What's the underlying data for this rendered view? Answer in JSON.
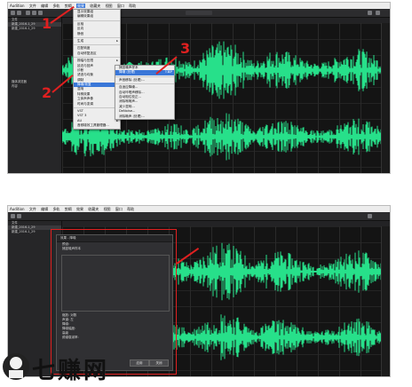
{
  "panel1": {
    "menubar": [
      "Audition",
      "文件",
      "编辑",
      "多轨",
      "剪辑",
      "效果",
      "收藏夹",
      "视图",
      "窗口",
      "帮助"
    ],
    "menubar_highlight_index": 5,
    "main_menu": [
      {
        "label": "显示效果组",
        "has_sub": false
      },
      {
        "label": "编辑效果组",
        "has_sub": false
      },
      {
        "label": "",
        "sep": true
      },
      {
        "label": "反相",
        "has_sub": false
      },
      {
        "label": "反向",
        "has_sub": false
      },
      {
        "label": "静音",
        "has_sub": false
      },
      {
        "label": "",
        "sep": true
      },
      {
        "label": "生成",
        "has_sub": true
      },
      {
        "label": "",
        "sep": true
      },
      {
        "label": "匹配响度",
        "has_sub": false
      },
      {
        "label": "自动修复选区",
        "has_sub": false
      },
      {
        "label": "",
        "sep": true
      },
      {
        "label": "振幅与压限",
        "has_sub": true
      },
      {
        "label": "延迟与回声",
        "has_sub": true
      },
      {
        "label": "诊断",
        "has_sub": true
      },
      {
        "label": "滤波与均衡",
        "has_sub": true
      },
      {
        "label": "调制",
        "has_sub": true
      },
      {
        "label": "降噪/恢复",
        "has_sub": true,
        "highlight": true
      },
      {
        "label": "混响",
        "has_sub": true
      },
      {
        "label": "特殊效果",
        "has_sub": true
      },
      {
        "label": "立体声声像",
        "has_sub": true
      },
      {
        "label": "时间与变调",
        "has_sub": true
      },
      {
        "label": "",
        "sep": true
      },
      {
        "label": "VST",
        "has_sub": true
      },
      {
        "label": "VST 3",
        "has_sub": true
      },
      {
        "label": "AU",
        "has_sub": true
      },
      {
        "label": "音频增效工具管理器...",
        "has_sub": false
      }
    ],
    "submenu": [
      {
        "label": "捕捉噪声样本",
        "highlight": false
      },
      {
        "label": "降噪 (处理)",
        "highlight": true,
        "shortcut": "⇧⌘P"
      },
      {
        "label": "",
        "sep": true
      },
      {
        "label": "声音移除 (处理)...",
        "highlight": false
      },
      {
        "label": "",
        "sep": true
      },
      {
        "label": "自适应降噪...",
        "highlight": false
      },
      {
        "label": "自动咔嗒声移除...",
        "highlight": false
      },
      {
        "label": "自动相位校正...",
        "highlight": false
      },
      {
        "label": "消除嗡嗡声...",
        "highlight": false
      },
      {
        "label": "减少混响...",
        "highlight": false
      },
      {
        "label": "DeNoise...",
        "highlight": false
      },
      {
        "label": "消除嘶声 (处理)...",
        "highlight": false
      }
    ],
    "files": [
      "新建_2016-1_29",
      "新建_2016-1_29"
    ],
    "left_rows": [
      "文件",
      "名称",
      "",
      "",
      "",
      "",
      "",
      "",
      "",
      "",
      "媒体浏览器",
      "内容",
      "",
      "",
      "",
      ""
    ],
    "annotations": [
      "1",
      "2",
      "3"
    ],
    "timecode": "0:00.000"
  },
  "panel2": {
    "menubar": [
      "Audition",
      "文件",
      "编辑",
      "多轨",
      "剪辑",
      "效果",
      "收藏夹",
      "视图",
      "窗口",
      "帮助"
    ],
    "dialog": {
      "title": "效果 - 降噪",
      "lines": [
        "预设:",
        "",
        "捕捉噪声样本",
        "选择完整文件",
        "噪声",
        "",
        "",
        "",
        "",
        "",
        "",
        "",
        "缩放: 对数",
        "声道: 左",
        "",
        "降噪:",
        "降噪幅度:",
        "",
        "高级",
        "频谱衰减率:",
        "平滑:",
        "精度因数:",
        "过渡宽度:",
        "FFT 大小:"
      ],
      "buttons": [
        "应用",
        "关闭"
      ]
    },
    "timecode": "0:00.000"
  },
  "watermark": {
    "text": "七赚网"
  },
  "colors": {
    "waveform": "#27e08a",
    "annotation": "#e02020",
    "highlight": "#3a77d8"
  }
}
